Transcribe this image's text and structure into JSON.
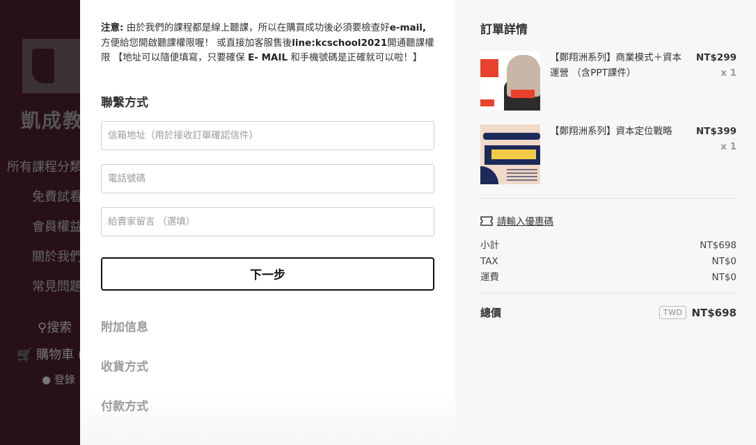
{
  "background": {
    "brand": "凱成教",
    "nav": [
      "所有課程分類",
      "免費試看",
      "會員權益",
      "關於我們",
      "常見問題"
    ],
    "search": "搜索",
    "cart": "購物車 (",
    "login": "登錄"
  },
  "notice": {
    "label": "注意:",
    "text1": " 由於我們的課程都是線上聽課，所以在購買成功後必須要檢查好",
    "email": "e-mail,",
    "text2": " 方便給您開啟聽課權限喔！ 或直接加客服售後",
    "line": "line:kcschool2021",
    "text3": "開通聽課權限 【地址可以隨便填寫，只要確保 ",
    "emailcaps": "E- MAIL",
    "text4": " 和手機號碼是正確就可以啦！】"
  },
  "contact": {
    "title": "聯繫方式",
    "email_placeholder": "信箱地址（用於接收訂單確認信件）",
    "phone_placeholder": "電話號碼",
    "message_placeholder": "給賣家留言 （選填）",
    "next_label": "下一步"
  },
  "sections": {
    "extra": "附加信息",
    "shipping": "收貨方式",
    "payment": "付款方式"
  },
  "order": {
    "title": "訂單詳情",
    "items": [
      {
        "name": "【鄭翔洲系列】商業模式＋資本運營 （含PPT課件）",
        "price": "NT$299",
        "qty": "x 1"
      },
      {
        "name": "【鄭翔洲系列】資本定位戰略",
        "price": "NT$399",
        "qty": "x 1"
      }
    ],
    "coupon": "請輸入優惠碼",
    "subtotal_label": "小計",
    "subtotal": "NT$698",
    "tax_label": "TAX",
    "tax": "NT$0",
    "shipping_label": "運費",
    "shipping": "NT$0",
    "total_label": "總價",
    "currency": "TWD",
    "total": "NT$698"
  }
}
